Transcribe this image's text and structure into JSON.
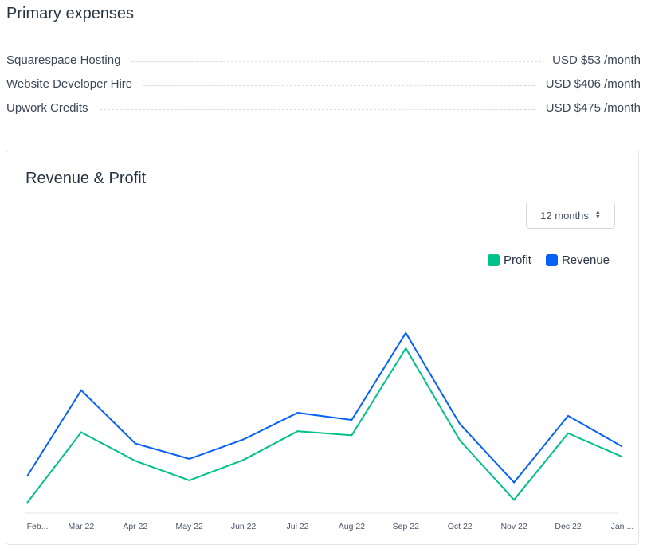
{
  "expenses": {
    "title": "Primary expenses",
    "items": [
      {
        "name": "Squarespace Hosting",
        "amount": "USD $53 /month"
      },
      {
        "name": "Website Developer Hire",
        "amount": "USD $406 /month"
      },
      {
        "name": "Upwork Credits",
        "amount": "USD $475 /month"
      }
    ]
  },
  "card": {
    "title": "Revenue & Profit",
    "range_label": "12 months",
    "legend": [
      {
        "label": "Profit",
        "color": "#00c08b"
      },
      {
        "label": "Revenue",
        "color": "#0561f5"
      }
    ]
  },
  "chart_data": {
    "type": "line",
    "categories": [
      "Feb...",
      "Mar 22",
      "Apr 22",
      "May 22",
      "Jun 22",
      "Jul 22",
      "Aug 22",
      "Sep 22",
      "Oct 22",
      "Nov 22",
      "Dec 22",
      "Jan ..."
    ],
    "series": [
      {
        "name": "Revenue",
        "color": "#0561f5",
        "values": [
          0.36,
          1.2,
          0.68,
          0.53,
          0.72,
          0.98,
          0.91,
          1.76,
          0.87,
          0.3,
          0.95,
          0.65
        ]
      },
      {
        "name": "Profit",
        "color": "#00c08b",
        "values": [
          0.1,
          0.79,
          0.51,
          0.32,
          0.52,
          0.8,
          0.76,
          1.61,
          0.71,
          0.13,
          0.78,
          0.55
        ]
      }
    ],
    "ylim": [
      0,
      2
    ],
    "grid": false,
    "legend": "top-right"
  }
}
